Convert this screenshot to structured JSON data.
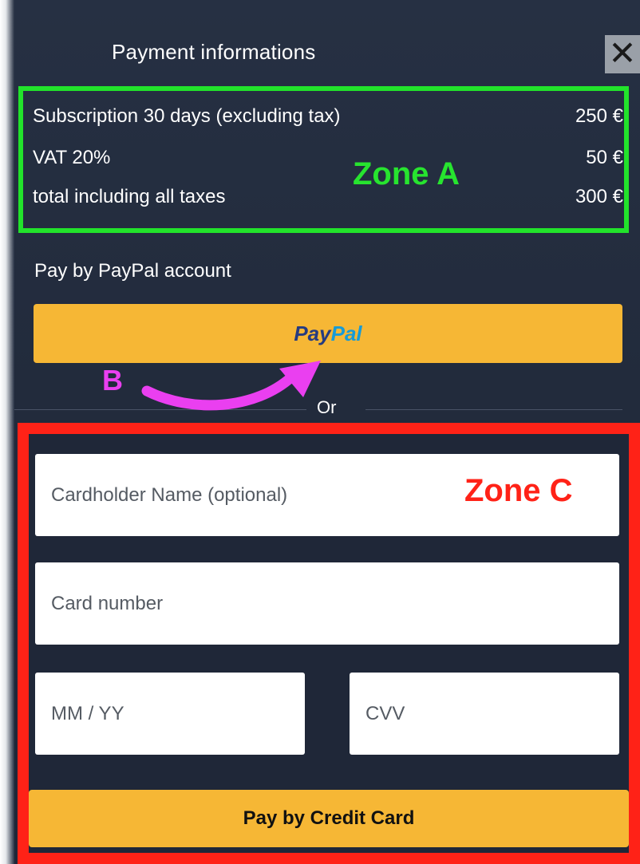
{
  "modal": {
    "title": "Payment informations",
    "close_symbol": "✕"
  },
  "zone_a": {
    "label": "Zone A",
    "color": "#22e32b",
    "rows": [
      {
        "label": "Subscription 30 days (excluding tax)",
        "amount": "250 €"
      },
      {
        "label": "VAT 20%",
        "amount": "50 €"
      },
      {
        "label": "total including all taxes",
        "amount": "300 €"
      }
    ]
  },
  "paypal": {
    "heading": "Pay by PayPal account",
    "logo_pay": "Pay",
    "logo_pal": "Pal",
    "button_color": "#f6b735"
  },
  "separator": {
    "text": "Or"
  },
  "annotation_b": {
    "label": "B",
    "color": "#ea3ff0"
  },
  "zone_c": {
    "label": "Zone C",
    "color": "#ff2217",
    "cardholder_placeholder": "Cardholder Name (optional)",
    "card_number_placeholder": "Card number",
    "expiry_placeholder": "MM / YY",
    "cvv_placeholder": "CVV",
    "submit_label": "Pay by Credit Card"
  }
}
